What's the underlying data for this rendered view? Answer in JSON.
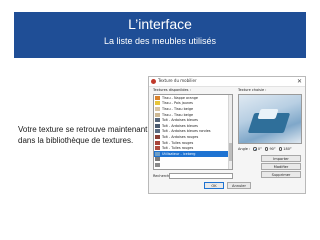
{
  "slide": {
    "title": "L’interface",
    "subtitle": "La liste des meubles utilisés",
    "caption": "Votre texture se retrouve maintenant dans la bibliothèque de textures.",
    "banner_color": "#1f4e96"
  },
  "dialog": {
    "title": "Texture du mobilier",
    "close_glyph": "✕",
    "available_label": "Textures disponibles :",
    "chosen_label": "Texture choisie :",
    "angle_label": "Angle :",
    "angle_options": [
      "0°",
      "90°",
      "180°"
    ],
    "angle_selected": "0°",
    "search_label": "Recherche :",
    "search_value": "",
    "buttons": {
      "import": "Importer",
      "modify": "Modifier",
      "delete": "Supprimer",
      "ok": "OK",
      "cancel": "Annuler"
    },
    "textures": [
      {
        "name": "Tissu - Nappe orange",
        "color": "#d9822b"
      },
      {
        "name": "Tissu - Pois jaunes",
        "color": "#e7c53a"
      },
      {
        "name": "Tissu - Tissu beige",
        "color": "#d8c3a0"
      },
      {
        "name": "Tissu - Tissu beige",
        "color": "#cdb893"
      },
      {
        "name": "Toit - Ardoises bleues",
        "color": "#55657a"
      },
      {
        "name": "Toit - Ardoises bleues",
        "color": "#4b5b70"
      },
      {
        "name": "Toit - Ardoises bleues rondes",
        "color": "#5a6b82"
      },
      {
        "name": "Toit - Ardoises rouges",
        "color": "#8a3f35"
      },
      {
        "name": "Toit - Tuiles rouges",
        "color": "#a9453a"
      },
      {
        "name": "Toit - Tuiles rouges",
        "color": "#b04c3f"
      },
      {
        "name": "Utilisateur - iceberg",
        "color": "#6f9fc7",
        "selected": true
      },
      {
        "name": "",
        "color": "#7a7a7a"
      },
      {
        "name": "",
        "color": "#8a8a8a"
      }
    ]
  }
}
